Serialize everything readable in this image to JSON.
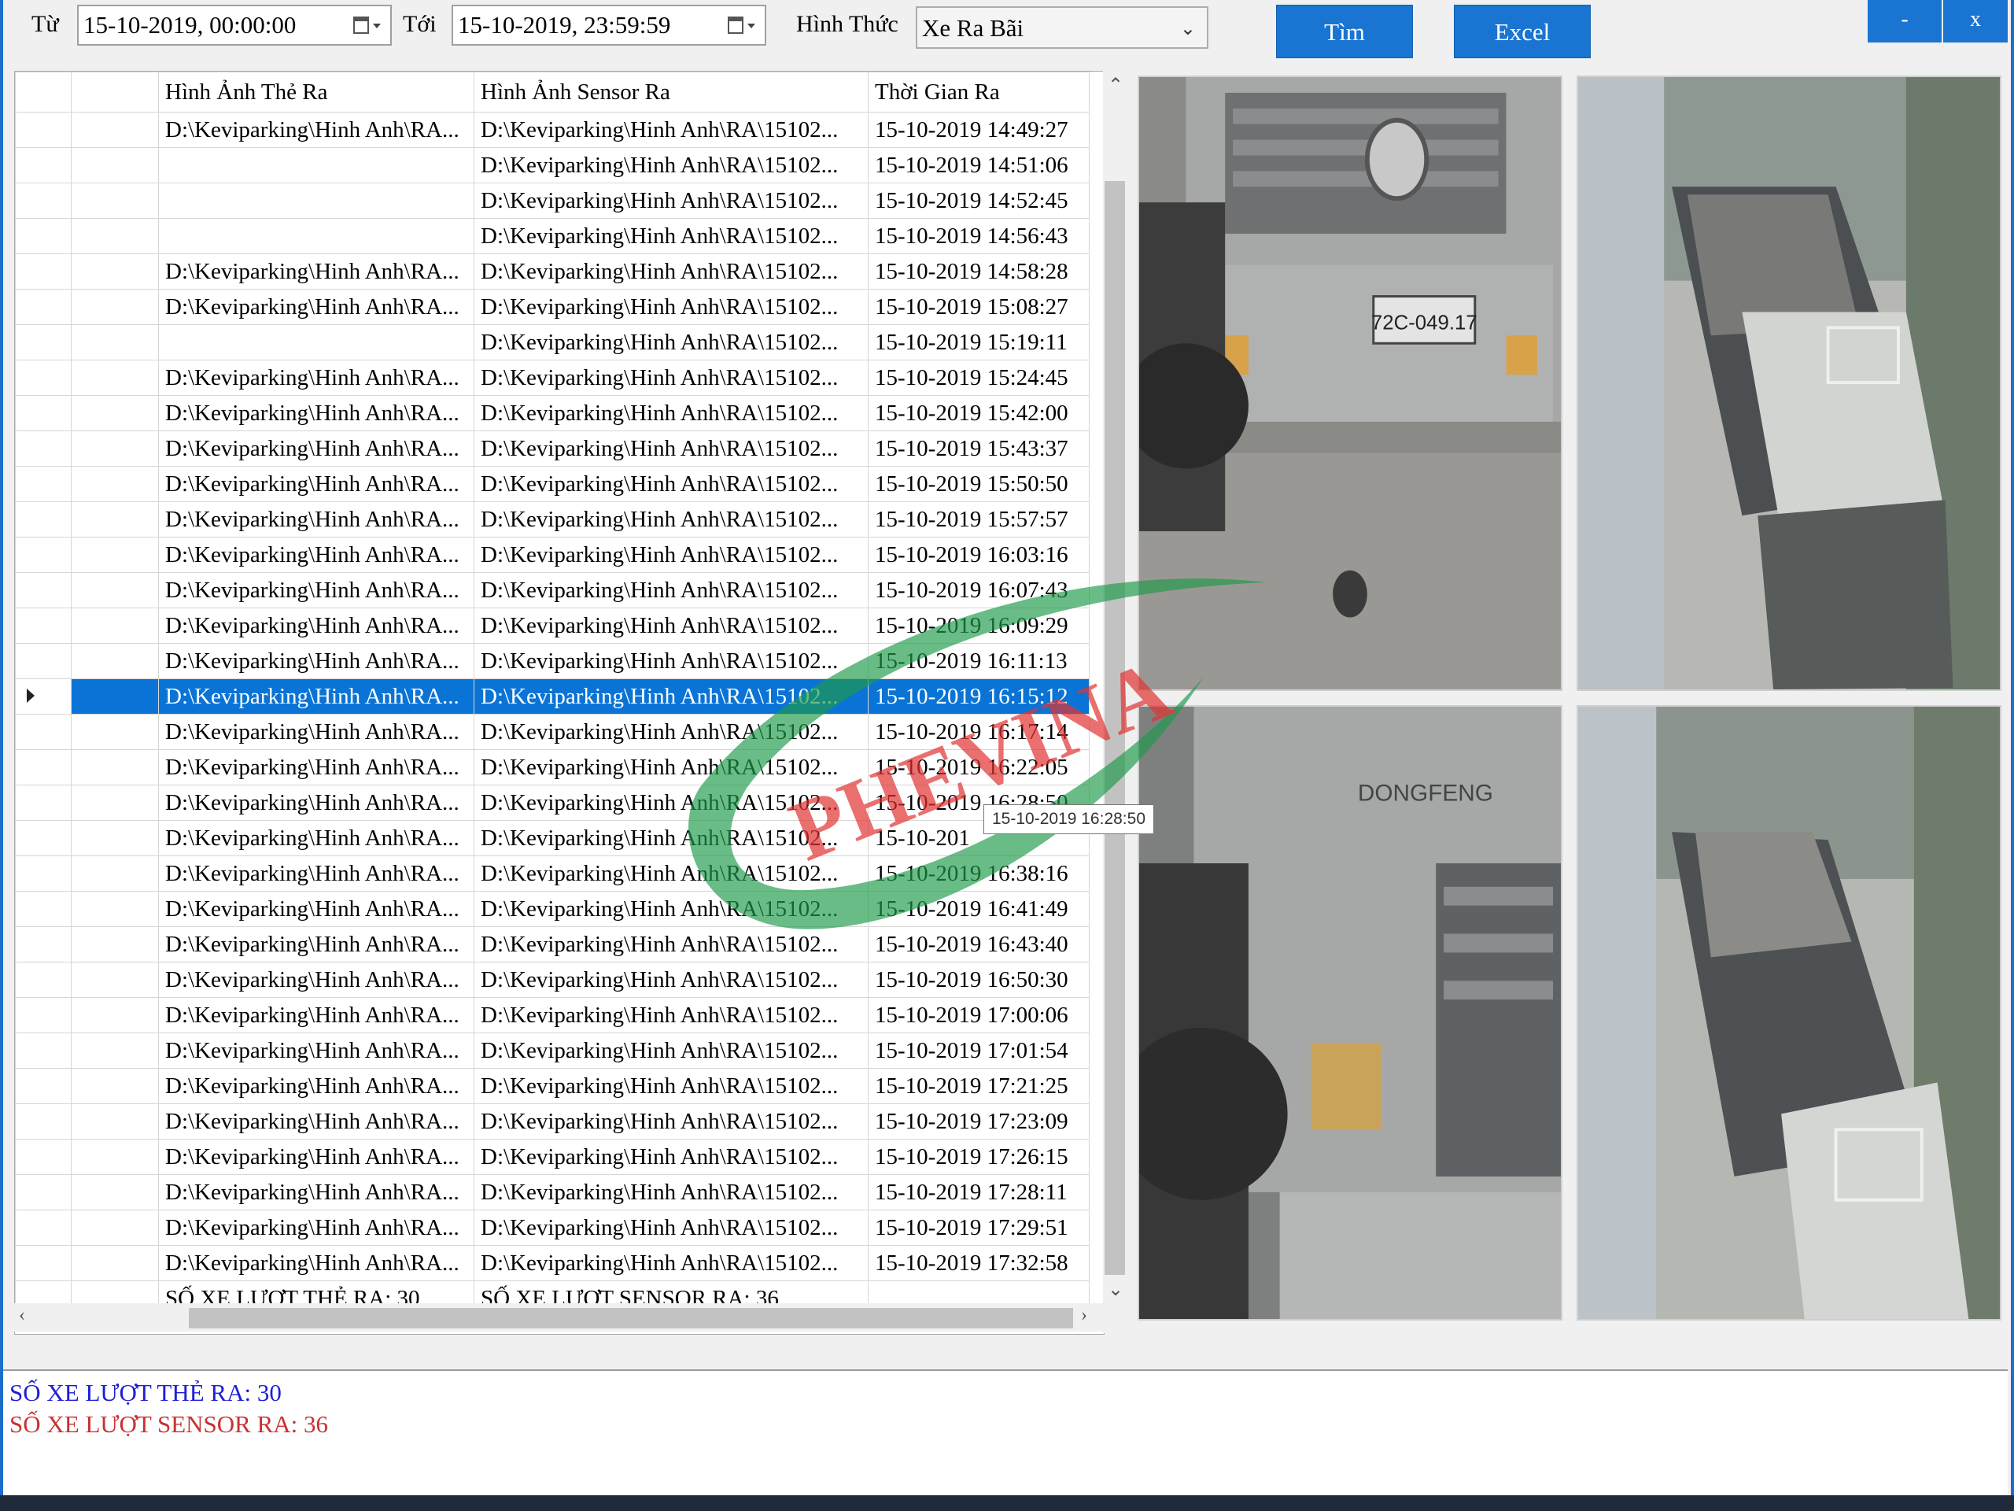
{
  "toolbar": {
    "from_label": "Từ",
    "from_value": "15-10-2019, 00:00:00",
    "to_label": "Tới",
    "to_value": "15-10-2019, 23:59:59",
    "mode_label": "Hình Thức",
    "mode_value": "Xe Ra Bãi",
    "search_label": "Tìm",
    "excel_label": "Excel",
    "minimize_label": "-",
    "close_label": "x"
  },
  "grid": {
    "columns": [
      "Hình Ảnh Thẻ Ra",
      "Hình Ảnh Sensor Ra",
      "Thời Gian Ra"
    ],
    "rows": [
      {
        "card": "D:\\Keviparking\\Hinh Anh\\RA...",
        "sensor": "D:\\Keviparking\\Hinh Anh\\RA\\15102...",
        "time": "15-10-2019 14:49:27"
      },
      {
        "card": "",
        "sensor": "D:\\Keviparking\\Hinh Anh\\RA\\15102...",
        "time": "15-10-2019 14:51:06"
      },
      {
        "card": "",
        "sensor": "D:\\Keviparking\\Hinh Anh\\RA\\15102...",
        "time": "15-10-2019 14:52:45"
      },
      {
        "card": "",
        "sensor": "D:\\Keviparking\\Hinh Anh\\RA\\15102...",
        "time": "15-10-2019 14:56:43"
      },
      {
        "card": "D:\\Keviparking\\Hinh Anh\\RA...",
        "sensor": "D:\\Keviparking\\Hinh Anh\\RA\\15102...",
        "time": "15-10-2019 14:58:28"
      },
      {
        "card": "D:\\Keviparking\\Hinh Anh\\RA...",
        "sensor": "D:\\Keviparking\\Hinh Anh\\RA\\15102...",
        "time": "15-10-2019 15:08:27"
      },
      {
        "card": "",
        "sensor": "D:\\Keviparking\\Hinh Anh\\RA\\15102...",
        "time": "15-10-2019 15:19:11"
      },
      {
        "card": "D:\\Keviparking\\Hinh Anh\\RA...",
        "sensor": "D:\\Keviparking\\Hinh Anh\\RA\\15102...",
        "time": "15-10-2019 15:24:45"
      },
      {
        "card": "D:\\Keviparking\\Hinh Anh\\RA...",
        "sensor": "D:\\Keviparking\\Hinh Anh\\RA\\15102...",
        "time": "15-10-2019 15:42:00"
      },
      {
        "card": "D:\\Keviparking\\Hinh Anh\\RA...",
        "sensor": "D:\\Keviparking\\Hinh Anh\\RA\\15102...",
        "time": "15-10-2019 15:43:37"
      },
      {
        "card": "D:\\Keviparking\\Hinh Anh\\RA...",
        "sensor": "D:\\Keviparking\\Hinh Anh\\RA\\15102...",
        "time": "15-10-2019 15:50:50"
      },
      {
        "card": "D:\\Keviparking\\Hinh Anh\\RA...",
        "sensor": "D:\\Keviparking\\Hinh Anh\\RA\\15102...",
        "time": "15-10-2019 15:57:57"
      },
      {
        "card": "D:\\Keviparking\\Hinh Anh\\RA...",
        "sensor": "D:\\Keviparking\\Hinh Anh\\RA\\15102...",
        "time": "15-10-2019 16:03:16"
      },
      {
        "card": "D:\\Keviparking\\Hinh Anh\\RA...",
        "sensor": "D:\\Keviparking\\Hinh Anh\\RA\\15102...",
        "time": "15-10-2019 16:07:43"
      },
      {
        "card": "D:\\Keviparking\\Hinh Anh\\RA...",
        "sensor": "D:\\Keviparking\\Hinh Anh\\RA\\15102...",
        "time": "15-10-2019 16:09:29"
      },
      {
        "card": "D:\\Keviparking\\Hinh Anh\\RA...",
        "sensor": "D:\\Keviparking\\Hinh Anh\\RA\\15102...",
        "time": "15-10-2019 16:11:13"
      },
      {
        "card": "D:\\Keviparking\\Hinh Anh\\RA...",
        "sensor": "D:\\Keviparking\\Hinh Anh\\RA\\15102...",
        "time": "15-10-2019 16:15:12",
        "selected": true
      },
      {
        "card": "D:\\Keviparking\\Hinh Anh\\RA...",
        "sensor": "D:\\Keviparking\\Hinh Anh\\RA\\15102...",
        "time": "15-10-2019 16:17:14"
      },
      {
        "card": "D:\\Keviparking\\Hinh Anh\\RA...",
        "sensor": "D:\\Keviparking\\Hinh Anh\\RA\\15102...",
        "time": "15-10-2019 16:22:05"
      },
      {
        "card": "D:\\Keviparking\\Hinh Anh\\RA...",
        "sensor": "D:\\Keviparking\\Hinh Anh\\RA\\15102...",
        "time": "15-10-2019 16:28:50"
      },
      {
        "card": "D:\\Keviparking\\Hinh Anh\\RA...",
        "sensor": "D:\\Keviparking\\Hinh Anh\\RA\\15102...",
        "time": "15-10-201"
      },
      {
        "card": "D:\\Keviparking\\Hinh Anh\\RA...",
        "sensor": "D:\\Keviparking\\Hinh Anh\\RA\\15102...",
        "time": "15-10-2019 16:38:16"
      },
      {
        "card": "D:\\Keviparking\\Hinh Anh\\RA...",
        "sensor": "D:\\Keviparking\\Hinh Anh\\RA\\15102...",
        "time": "15-10-2019 16:41:49"
      },
      {
        "card": "D:\\Keviparking\\Hinh Anh\\RA...",
        "sensor": "D:\\Keviparking\\Hinh Anh\\RA\\15102...",
        "time": "15-10-2019 16:43:40"
      },
      {
        "card": "D:\\Keviparking\\Hinh Anh\\RA...",
        "sensor": "D:\\Keviparking\\Hinh Anh\\RA\\15102...",
        "time": "15-10-2019 16:50:30"
      },
      {
        "card": "D:\\Keviparking\\Hinh Anh\\RA...",
        "sensor": "D:\\Keviparking\\Hinh Anh\\RA\\15102...",
        "time": "15-10-2019 17:00:06"
      },
      {
        "card": "D:\\Keviparking\\Hinh Anh\\RA...",
        "sensor": "D:\\Keviparking\\Hinh Anh\\RA\\15102...",
        "time": "15-10-2019 17:01:54"
      },
      {
        "card": "D:\\Keviparking\\Hinh Anh\\RA...",
        "sensor": "D:\\Keviparking\\Hinh Anh\\RA\\15102...",
        "time": "15-10-2019 17:21:25"
      },
      {
        "card": "D:\\Keviparking\\Hinh Anh\\RA...",
        "sensor": "D:\\Keviparking\\Hinh Anh\\RA\\15102...",
        "time": "15-10-2019 17:23:09"
      },
      {
        "card": "D:\\Keviparking\\Hinh Anh\\RA...",
        "sensor": "D:\\Keviparking\\Hinh Anh\\RA\\15102...",
        "time": "15-10-2019 17:26:15"
      },
      {
        "card": "D:\\Keviparking\\Hinh Anh\\RA...",
        "sensor": "D:\\Keviparking\\Hinh Anh\\RA\\15102...",
        "time": "15-10-2019 17:28:11"
      },
      {
        "card": "D:\\Keviparking\\Hinh Anh\\RA...",
        "sensor": "D:\\Keviparking\\Hinh Anh\\RA\\15102...",
        "time": "15-10-2019 17:29:51"
      },
      {
        "card": "D:\\Keviparking\\Hinh Anh\\RA...",
        "sensor": "D:\\Keviparking\\Hinh Anh\\RA\\15102...",
        "time": "15-10-2019 17:32:58"
      }
    ],
    "total_card": "SỐ XE LƯỢT THẺ RA: 30",
    "total_sensor": "SỐ XE LƯỢT SENSOR RA: 36"
  },
  "tooltip": "15-10-2019 16:28:50",
  "images": {
    "plate_text": "72C-049.17",
    "grille_text": "DONGFENG"
  },
  "status": {
    "line1": "SỐ XE LƯỢT THẺ RA: 30",
    "line2": "SỐ XE LƯỢT SENSOR RA: 36",
    "line1_color": "#1f1fd6",
    "line2_color": "#c83232"
  },
  "colors": {
    "accent": "#1a74d2",
    "selected_row": "#0a74d6"
  }
}
